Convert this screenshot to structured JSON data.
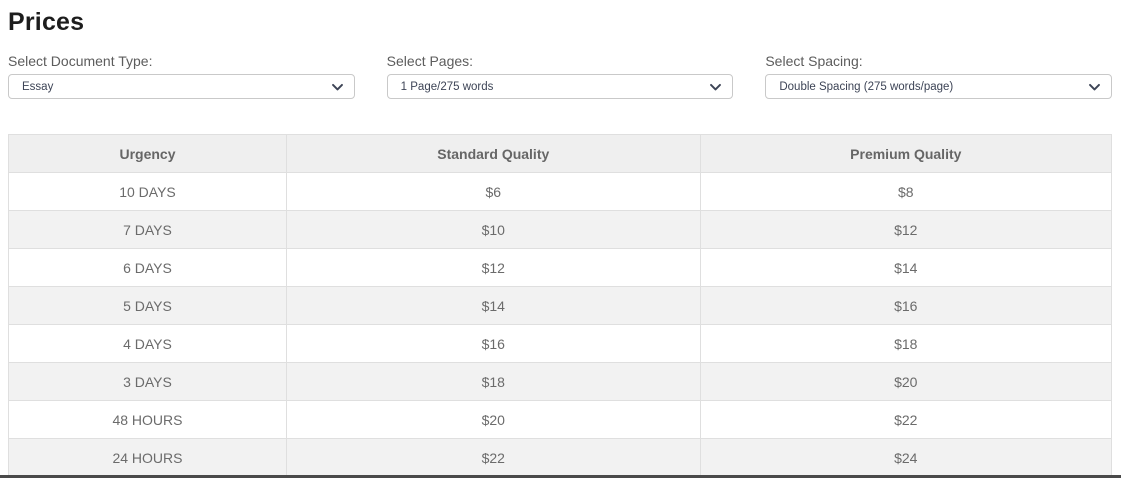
{
  "page": {
    "title": "Prices"
  },
  "filters": [
    {
      "label": "Select Document Type:",
      "value": "Essay"
    },
    {
      "label": "Select Pages:",
      "value": "1 Page/275 words"
    },
    {
      "label": "Select Spacing:",
      "value": "Double Spacing (275 words/page)"
    }
  ],
  "table": {
    "headers": [
      "Urgency",
      "Standard Quality",
      "Premium Quality"
    ],
    "rows": [
      [
        "10 DAYS",
        "$6",
        "$8"
      ],
      [
        "7 DAYS",
        "$10",
        "$12"
      ],
      [
        "6 DAYS",
        "$12",
        "$14"
      ],
      [
        "5 DAYS",
        "$14",
        "$16"
      ],
      [
        "4 DAYS",
        "$16",
        "$18"
      ],
      [
        "3 DAYS",
        "$18",
        "$20"
      ],
      [
        "48 HOURS",
        "$20",
        "$22"
      ],
      [
        "24 HOURS",
        "$22",
        "$24"
      ]
    ]
  },
  "colors": {
    "header_bg": "#efefef",
    "stripe_bg": "#f2f2f2",
    "border": "#dfdfdf",
    "text_muted": "#6b6b6b",
    "heading_text": "#1d1d1d",
    "label_text": "#5c5c5c",
    "select_text": "#3d4456",
    "footer_edge": "#4a4a4a"
  }
}
